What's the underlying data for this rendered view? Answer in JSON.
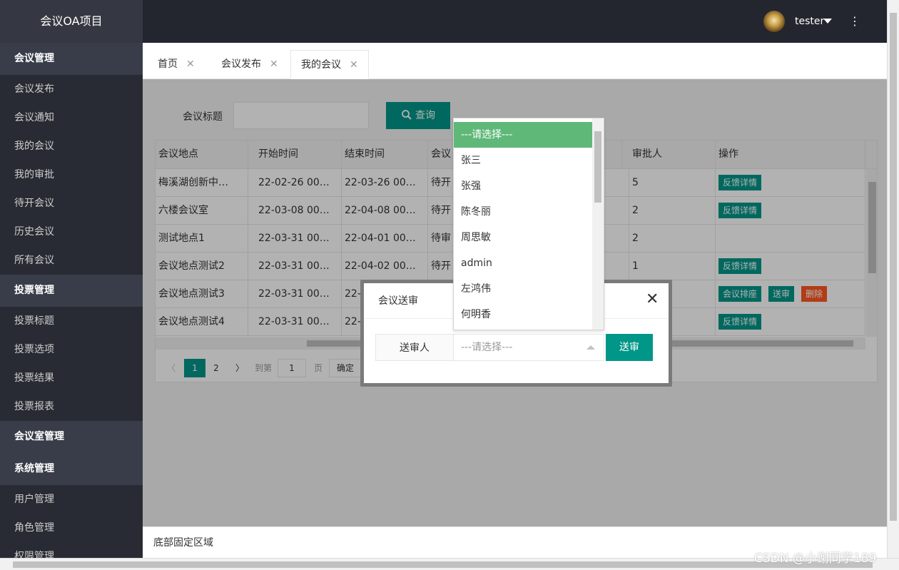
{
  "app_title": "会议OA项目",
  "sidebar": {
    "groups": [
      {
        "label": "会议管理",
        "items": [
          "会议发布",
          "会议通知",
          "我的会议",
          "我的审批",
          "待开会议",
          "历史会议",
          "所有会议"
        ]
      },
      {
        "label": "投票管理",
        "items": [
          "投票标题",
          "投票选项",
          "投票结果",
          "投票报表"
        ]
      },
      {
        "label": "会议室管理",
        "items": []
      },
      {
        "label": "系统管理",
        "items": [
          "用户管理",
          "角色管理",
          "权限管理"
        ]
      }
    ]
  },
  "header": {
    "username": "tester",
    "more": "⋮"
  },
  "tabs": [
    {
      "label": "首页",
      "close": "✕"
    },
    {
      "label": "会议发布",
      "close": "✕"
    },
    {
      "label": "我的会议",
      "close": "✕"
    }
  ],
  "search": {
    "label": "会议标题",
    "value": "",
    "button": "查询"
  },
  "table": {
    "columns": [
      "会议地点",
      "开始时间",
      "结束时间",
      "会议",
      "审批人",
      "操作"
    ],
    "rows": [
      {
        "place": "梅溪湖创新中…",
        "start": "22-02-26 00…",
        "end": "22-03-26 00…",
        "status": "待开",
        "approver": "5",
        "actions": [
          "反馈详情"
        ]
      },
      {
        "place": "六楼会议室",
        "start": "22-03-08 00…",
        "end": "22-04-08 00…",
        "status": "待开",
        "approver": "2",
        "actions": [
          "反馈详情"
        ]
      },
      {
        "place": "测试地点1",
        "start": "22-03-31 00…",
        "end": "22-04-01 00…",
        "status": "待审",
        "approver": "2",
        "actions": []
      },
      {
        "place": "会议地点测试2",
        "start": "22-03-31 00…",
        "end": "22-04-02 00…",
        "status": "待开",
        "approver": "1",
        "actions": [
          "反馈详情"
        ]
      },
      {
        "place": "会议地点测试3",
        "start": "22-03-31 00…",
        "end": "22-0",
        "status": "",
        "approver": "",
        "actions": [
          "会议排座",
          "送审",
          "删除"
        ]
      },
      {
        "place": "会议地点测试4",
        "start": "22-03-31 00…",
        "end": "22-0",
        "status": "",
        "approver": "",
        "actions": [
          "反馈详情"
        ]
      }
    ]
  },
  "pager": {
    "prev": "〈",
    "pages": [
      "1",
      "2"
    ],
    "current": "1",
    "next": "〉",
    "goto_label": "到第",
    "goto_value": "1",
    "page_unit": "页",
    "confirm": "确定"
  },
  "modal": {
    "title": "会议送审",
    "close": "✕",
    "field_label": "送审人",
    "select_placeholder": "---请选择---",
    "submit": "送审"
  },
  "dropdown": {
    "options": [
      "---请选择---",
      "张三",
      "张强",
      "陈冬丽",
      "周思敏",
      "admin",
      "左鸿伟",
      "何明香"
    ],
    "selected_index": 0
  },
  "footer": {
    "text": "底部固定区域"
  },
  "watermark": "CSDN @小谢同学189",
  "colors": {
    "accent": "#009688",
    "danger": "#ff5722",
    "dropdown_selected": "#5fb878",
    "sidebar_bg": "#282b33",
    "header_bg": "#23262e"
  }
}
